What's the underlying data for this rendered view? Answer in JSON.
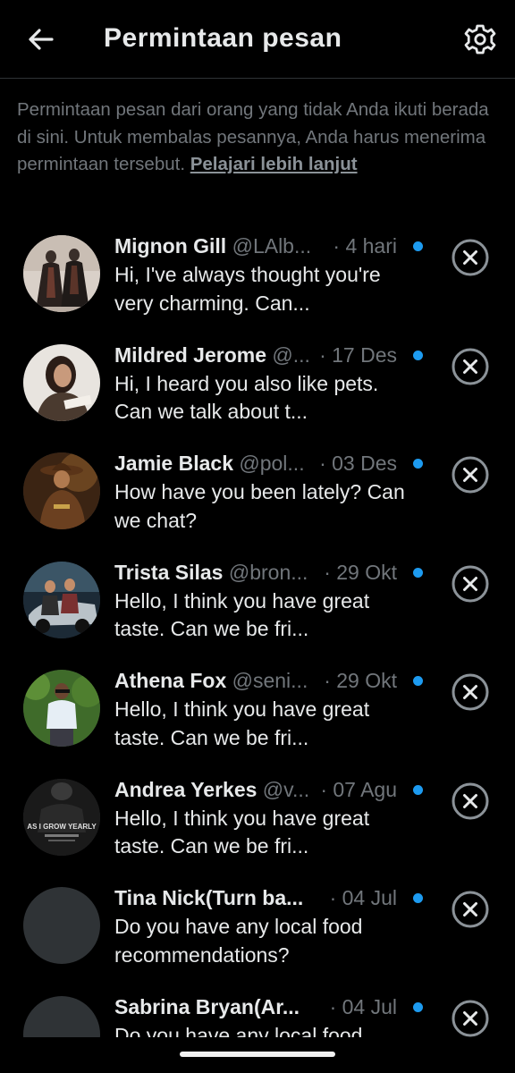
{
  "header": {
    "title": "Permintaan pesan",
    "back_icon": "arrow-left-icon",
    "settings_icon": "gear-icon"
  },
  "info": {
    "text": "Permintaan pesan dari orang yang tidak Anda ikuti berada di sini. Untuk membalas pesannya, Anda harus menerima permintaan tersebut. ",
    "link": "Pelajari lebih lanjut"
  },
  "colors": {
    "background": "#000000",
    "text_primary": "#e7e9ea",
    "text_secondary": "#71767b",
    "unread_dot": "#1d9bf0",
    "avatar_placeholder": "#2f3336"
  },
  "requests": [
    {
      "name": "Mignon Gill",
      "handle": "@LAlb...",
      "date": "· 4 hari",
      "message": "Hi, I've always thought you're very charming. Can...",
      "avatar": "photo-two-women-vintage-dresses"
    },
    {
      "name": "Mildred Jerome",
      "handle": "@...",
      "date": "· 17 Des",
      "message": "Hi, I heard you also like pets. Can we talk about t...",
      "avatar": "photo-woman-writing"
    },
    {
      "name": "Jamie Black",
      "handle": "@pol...",
      "date": "· 03 Des",
      "message": "How have you been lately? Can we chat?",
      "avatar": "photo-cowboy-illustration"
    },
    {
      "name": "Trista Silas",
      "handle": "@bron...",
      "date": "· 29 Okt",
      "message": "Hello, I think you have great taste. Can we be fri...",
      "avatar": "photo-couple-with-car"
    },
    {
      "name": "Athena Fox",
      "handle": "@seni...",
      "date": "· 29 Okt",
      "message": "Hello, I think you have great taste. Can we be fri...",
      "avatar": "photo-man-in-garden"
    },
    {
      "name": "Andrea Yerkes",
      "handle": "@v...",
      "date": "· 07 Agu",
      "message": "Hello, I think you have great taste. Can we be fri...",
      "avatar": "photo-dark-poster",
      "avatar_text": "AS I GROW YEARLY"
    },
    {
      "name": "Tina Nick(Turn ba...",
      "handle": "",
      "date": "· 04 Jul",
      "message": "Do you have any local food recommendations?",
      "avatar": "placeholder"
    },
    {
      "name": "Sabrina Bryan(Ar...",
      "handle": "",
      "date": "· 04 Jul",
      "message": "Do you have any local food recommendations?",
      "avatar": "placeholder"
    }
  ]
}
